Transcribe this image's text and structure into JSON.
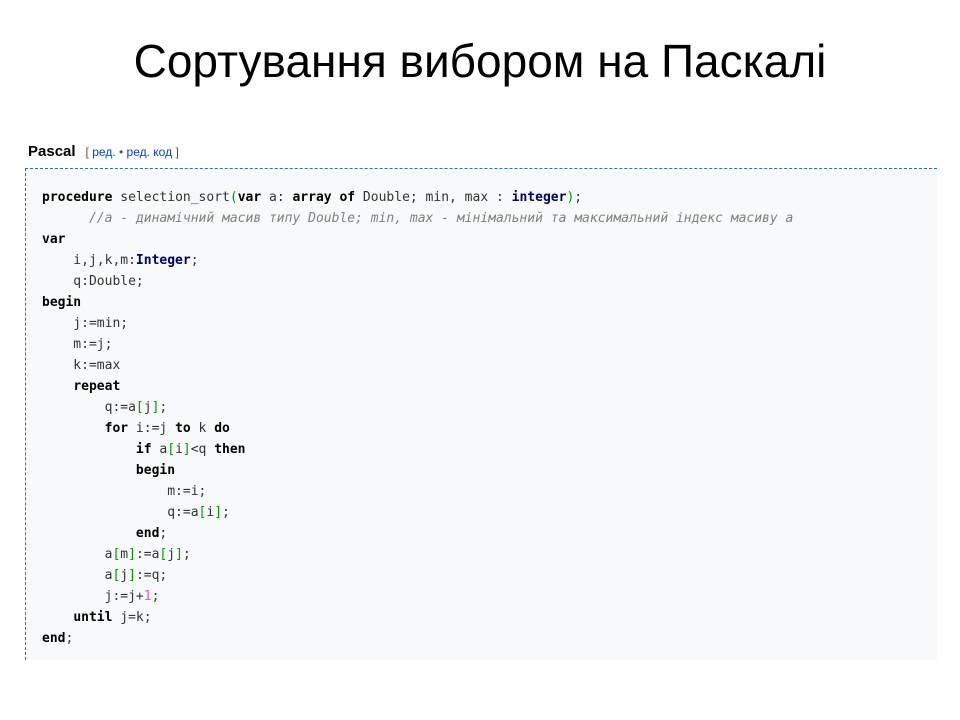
{
  "slide": {
    "title": "Сортування вибором на Паскалі"
  },
  "section": {
    "language": "Pascal",
    "bracket_open": "[",
    "edit_label": "ред.",
    "separator": "•",
    "edit_code_label": "ред. код",
    "bracket_close": "]"
  },
  "code_lines": [
    [
      [
        "kw",
        "procedure"
      ],
      [
        "tx",
        " selection_sort"
      ],
      [
        "br",
        "("
      ],
      [
        "kw",
        "var"
      ],
      [
        "tx",
        " a: "
      ],
      [
        "kw",
        "array"
      ],
      [
        "tx",
        " "
      ],
      [
        "kw",
        "of"
      ],
      [
        "tx",
        " Double; min, max : "
      ],
      [
        "ty",
        "integer"
      ],
      [
        "br",
        ")"
      ],
      [
        "tx",
        ";"
      ]
    ],
    [
      [
        "tx",
        "      "
      ],
      [
        "cm",
        "//a - динамічний масив типу Double; min, max - мінімальний та максимальний індекс масиву a"
      ]
    ],
    [
      [
        "kw",
        "var"
      ]
    ],
    [
      [
        "tx",
        "    i,j,k,m:"
      ],
      [
        "ty",
        "Integer"
      ],
      [
        "tx",
        ";"
      ]
    ],
    [
      [
        "tx",
        "    q:Double;"
      ]
    ],
    [
      [
        "kw",
        "begin"
      ]
    ],
    [
      [
        "tx",
        "    j:=min;"
      ]
    ],
    [
      [
        "tx",
        "    m:=j;"
      ]
    ],
    [
      [
        "tx",
        "    k:=max"
      ]
    ],
    [
      [
        "tx",
        "    "
      ],
      [
        "kw",
        "repeat"
      ]
    ],
    [
      [
        "tx",
        "        q:=a"
      ],
      [
        "br",
        "["
      ],
      [
        "tx",
        "j"
      ],
      [
        "br",
        "]"
      ],
      [
        "tx",
        ";"
      ]
    ],
    [
      [
        "tx",
        "        "
      ],
      [
        "kw",
        "for"
      ],
      [
        "tx",
        " i:=j "
      ],
      [
        "kw",
        "to"
      ],
      [
        "tx",
        " k "
      ],
      [
        "kw",
        "do"
      ]
    ],
    [
      [
        "tx",
        "            "
      ],
      [
        "kw",
        "if"
      ],
      [
        "tx",
        " a"
      ],
      [
        "br",
        "["
      ],
      [
        "tx",
        "i"
      ],
      [
        "br",
        "]"
      ],
      [
        "tx",
        "<q "
      ],
      [
        "kw",
        "then"
      ]
    ],
    [
      [
        "tx",
        "            "
      ],
      [
        "kw",
        "begin"
      ]
    ],
    [
      [
        "tx",
        "                m:=i;"
      ]
    ],
    [
      [
        "tx",
        "                q:=a"
      ],
      [
        "br",
        "["
      ],
      [
        "tx",
        "i"
      ],
      [
        "br",
        "]"
      ],
      [
        "tx",
        ";"
      ]
    ],
    [
      [
        "tx",
        "            "
      ],
      [
        "kw",
        "end"
      ],
      [
        "tx",
        ";"
      ]
    ],
    [
      [
        "tx",
        "        a"
      ],
      [
        "br",
        "["
      ],
      [
        "tx",
        "m"
      ],
      [
        "br",
        "]"
      ],
      [
        "tx",
        ":=a"
      ],
      [
        "br",
        "["
      ],
      [
        "tx",
        "j"
      ],
      [
        "br",
        "]"
      ],
      [
        "tx",
        ";"
      ]
    ],
    [
      [
        "tx",
        "        a"
      ],
      [
        "br",
        "["
      ],
      [
        "tx",
        "j"
      ],
      [
        "br",
        "]"
      ],
      [
        "tx",
        ":=q;"
      ]
    ],
    [
      [
        "tx",
        "        j:=j+"
      ],
      [
        "nu",
        "1"
      ],
      [
        "tx",
        ";"
      ]
    ],
    [
      [
        "tx",
        "    "
      ],
      [
        "kw",
        "until"
      ],
      [
        "tx",
        " j=k;"
      ]
    ],
    [
      [
        "kw",
        "end"
      ],
      [
        "tx",
        ";"
      ]
    ]
  ]
}
